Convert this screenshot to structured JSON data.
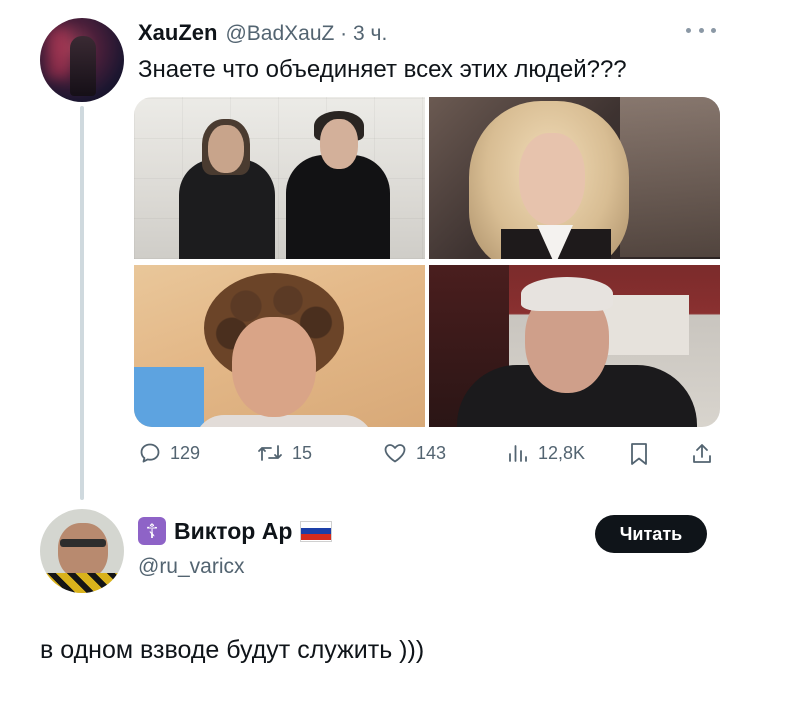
{
  "tweet": {
    "author_name": "XauZen",
    "author_handle_time": "@BadXauZ · 3 ч.",
    "text": "Знаете что объединяет всех этих людей???",
    "stats": {
      "replies": "129",
      "retweets": "15",
      "likes": "143",
      "views": "12,8K"
    }
  },
  "reply": {
    "author_badge": "☦",
    "author_name": "Виктор Ар",
    "author_handle": "@ru_varicx",
    "follow_label": "Читать",
    "text": "в одном взводе будут служить )))"
  },
  "icons": {
    "reply": "speech-bubble-icon",
    "retweet": "retweet-icon",
    "like": "heart-icon",
    "views": "bar-chart-icon",
    "bookmark": "bookmark-icon",
    "share": "share-icon",
    "more": "more-dots-icon",
    "flag": "russia-flag-icon",
    "badge": "orthodox-cross-icon"
  },
  "colors": {
    "text": "#0f1419",
    "secondary": "#536471",
    "thread_line": "#cfd9de",
    "button_bg": "#0f1419",
    "badge_bg": "#8e63c7"
  }
}
